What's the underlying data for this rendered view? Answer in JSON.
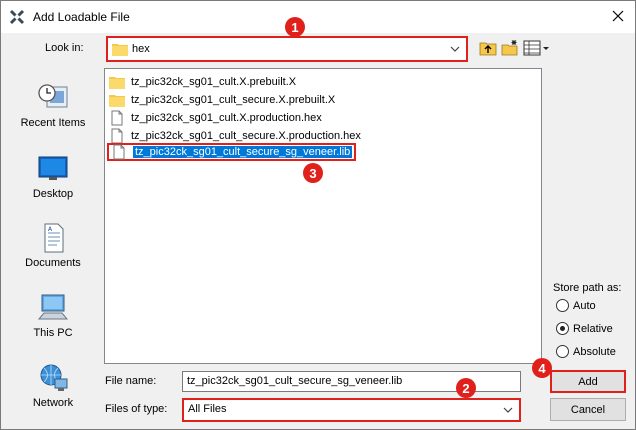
{
  "window": {
    "title": "Add Loadable File",
    "app_icon": "x-logo-icon",
    "close": "close-icon"
  },
  "lookin": {
    "label": "Look in:",
    "value": "hex"
  },
  "toolbar": {
    "icons": [
      "up-folder-icon",
      "new-folder-icon",
      "view-menu-icon"
    ]
  },
  "places": [
    {
      "label": "Recent Items",
      "icon": "recent-items-icon"
    },
    {
      "label": "Desktop",
      "icon": "desktop-icon"
    },
    {
      "label": "Documents",
      "icon": "documents-icon"
    },
    {
      "label": "This PC",
      "icon": "this-pc-icon"
    },
    {
      "label": "Network",
      "icon": "network-icon"
    }
  ],
  "files": [
    {
      "name": "tz_pic32ck_sg01_cult.X.prebuilt.X",
      "type": "folder"
    },
    {
      "name": "tz_pic32ck_sg01_cult_secure.X.prebuilt.X",
      "type": "folder"
    },
    {
      "name": "tz_pic32ck_sg01_cult.X.production.hex",
      "type": "file"
    },
    {
      "name": "tz_pic32ck_sg01_cult_secure.X.production.hex",
      "type": "file"
    },
    {
      "name": "tz_pic32ck_sg01_cult_secure_sg_veneer.lib",
      "type": "file",
      "selected": true
    }
  ],
  "filename": {
    "label": "File name:",
    "value": "tz_pic32ck_sg01_cult_secure_sg_veneer.lib"
  },
  "filetype": {
    "label": "Files of type:",
    "value": "All Files"
  },
  "store_path": {
    "label": "Store path as:",
    "options": [
      {
        "label": "Auto",
        "checked": false
      },
      {
        "label": "Relative",
        "checked": true
      },
      {
        "label": "Absolute",
        "checked": false
      }
    ]
  },
  "buttons": {
    "add": "Add",
    "cancel": "Cancel"
  },
  "markers": [
    "1",
    "2",
    "3",
    "4"
  ],
  "colors": {
    "highlight": "#e0201b",
    "selection": "#0078d7"
  }
}
